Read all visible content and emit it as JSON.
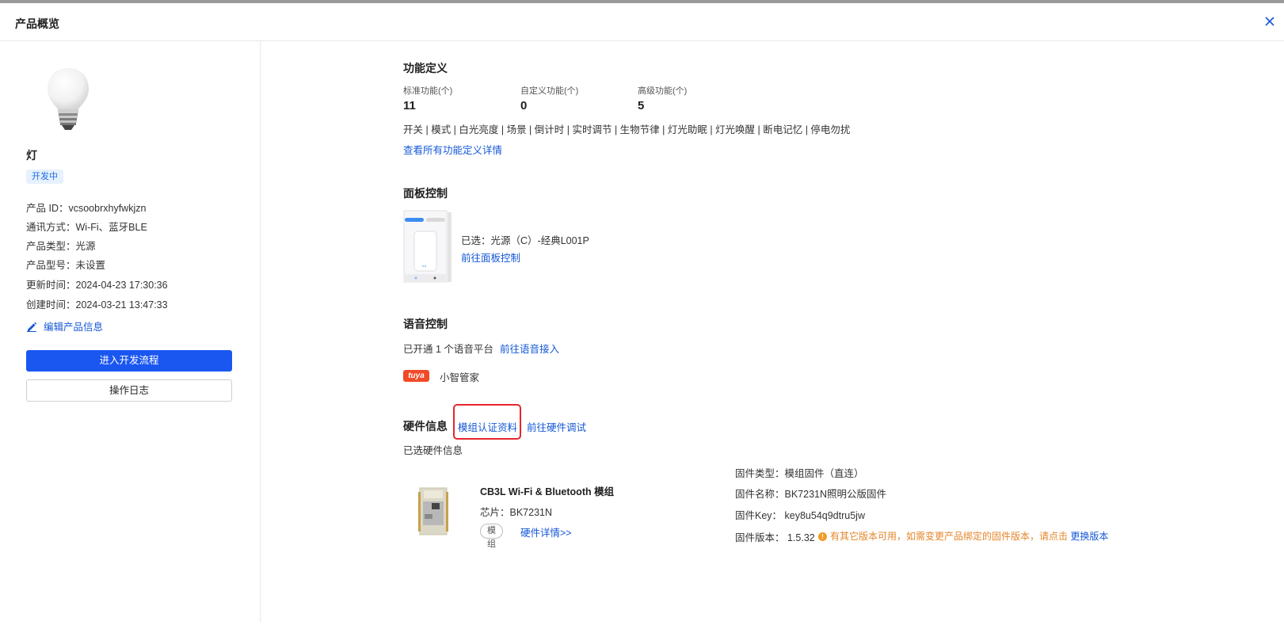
{
  "header": {
    "title": "产品概览",
    "close_icon": "close-icon"
  },
  "product": {
    "image_icon": "bulb-icon",
    "name": "灯",
    "status": "开发中",
    "info": [
      "产品 ID：vcsoobrxhyfwkjzn",
      "通讯方式：Wi-Fi、蓝牙BLE",
      "产品类型：光源",
      "产品型号：未设置",
      "更新时间：2024-04-23 17:30:36",
      "创建时间：2024-03-21 13:47:33"
    ],
    "edit_label": "编辑产品信息",
    "edit_icon": "pencil-icon",
    "primary_button": "进入开发流程",
    "log_button": "操作日志"
  },
  "function_def": {
    "title": "功能定义",
    "stats": [
      {
        "label": "标准功能(个)",
        "value": "11"
      },
      {
        "label": "自定义功能(个)",
        "value": "0"
      },
      {
        "label": "高级功能(个)",
        "value": "5"
      }
    ],
    "functions_text": "开关 | 模式 | 白光亮度 | 场景 | 倒计时 | 实时调节 | 生物节律 | 灯光助眠 | 灯光唤醒 | 断电记忆 | 停电勿扰",
    "details_link": "查看所有功能定义详情"
  },
  "panel_control": {
    "title": "面板控制",
    "selected": "已选：光源（C）-经典L001P",
    "link": "前往面板控制"
  },
  "voice_control": {
    "title": "语音控制",
    "status_text": "已开通 1 个语音平台",
    "link": "前往语音接入",
    "platform_logo": "tuya",
    "platform_name": "小智管家"
  },
  "hardware": {
    "title": "硬件信息",
    "cert_link": "模组认证资料",
    "debug_link": "前往硬件调试",
    "selected_label": "已选硬件信息",
    "module_name": "CB3L Wi-Fi & Bluetooth 模组",
    "chip": "芯片：BK7231N",
    "tag": "模组",
    "details_link": "硬件详情>>",
    "firmware_type": "固件类型：模组固件（直连）",
    "firmware_name": "固件名称：BK7231N照明公版固件",
    "firmware_key": "固件Key：  key8u54q9dtru5jw",
    "firmware_version": "固件版本：  1.5.32",
    "warning_icon": "warning-icon",
    "warning_text": "有其它版本可用，如需变更产品绑定的固件版本，请点击 ",
    "warning_link": "更换版本"
  }
}
